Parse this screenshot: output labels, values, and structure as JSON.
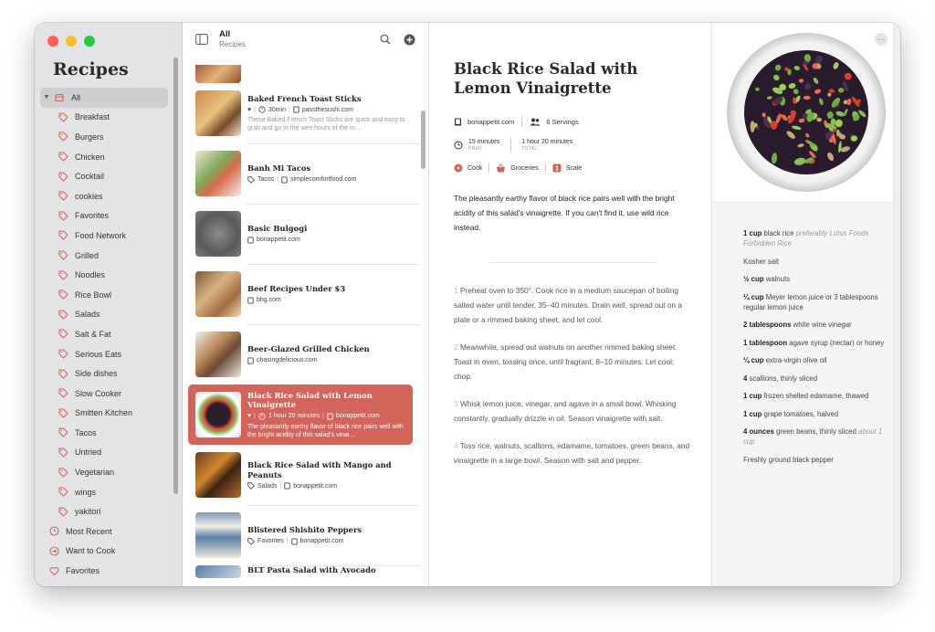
{
  "sidebar": {
    "title": "Recipes",
    "all_label": "All",
    "tags": [
      "Breakfast",
      "Burgers",
      "Chicken",
      "Cocktail",
      "cookies",
      "Favorites",
      "Food Network",
      "Grilled",
      "Noodles",
      "Rice Bowl",
      "Salads",
      "Salt & Fat",
      "Serious Eats",
      "Side dishes",
      "Slow Cooker",
      "Smitten Kitchen",
      "Tacos",
      "Untried",
      "Vegetarian",
      "wings",
      "yakitori"
    ],
    "smart": [
      {
        "label": "Most Recent",
        "icon": "clock-icon"
      },
      {
        "label": "Want to Cook",
        "icon": "arrow-circle-icon"
      },
      {
        "label": "Favorites",
        "icon": "heart-icon"
      }
    ],
    "accent": "#d2645a"
  },
  "list": {
    "title": "All",
    "subtitle": "Recipes",
    "items": [
      {
        "title": "Baked French Toast Sticks",
        "meta": [
          "♥",
          "30min",
          "passthesushi.com"
        ],
        "desc": "These Baked French Toast Sticks are quick and easy to grab and go in the wee hours of the m…"
      },
      {
        "title": "Banh Mi Tacos",
        "meta": [
          "Tacos",
          "simplecomfortfood.com"
        ],
        "desc": ""
      },
      {
        "title": "Basic Bulgogi",
        "meta": [
          "bonappetit.com"
        ],
        "desc": ""
      },
      {
        "title": "Beef Recipes Under $3",
        "meta": [
          "bhg.com"
        ],
        "desc": ""
      },
      {
        "title": "Beer-Glazed Grilled Chicken",
        "meta": [
          "chasingdelicious.com"
        ],
        "desc": ""
      },
      {
        "title": "Black Rice Salad with Lemon Vinaigrette",
        "meta": [
          "♥",
          "1 hour 20 minutes",
          "bonappetit.com"
        ],
        "desc": "The pleasantly earthy flavor of black rice pairs well with the bright acidity of this salad's vinai…"
      },
      {
        "title": "Black Rice Salad with Mango and Peanuts",
        "meta": [
          "Salads",
          "bonappetit.com"
        ],
        "desc": ""
      },
      {
        "title": "Blistered Shishito Peppers",
        "meta": [
          "Favorites",
          "bonappetit.com"
        ],
        "desc": ""
      },
      {
        "title": "BLT Pasta Salad with Avocado",
        "meta": [],
        "desc": ""
      }
    ]
  },
  "recipe": {
    "title": "Black Rice Salad with Lemon Vinaigrette",
    "source": "bonappetit.com",
    "servings": "6 Servings",
    "prep_time": "15 minutes",
    "prep_label": "PREP",
    "total_time": "1 hour 20 minutes",
    "total_label": "TOTAL",
    "actions": [
      "Cook",
      "Groceries",
      "Scale"
    ],
    "summary": "The pleasantly earthy flavor of black rice pairs well with the bright acidity of this salad's vinaigrette. If you can't find it, use wild rice instead.",
    "steps": [
      {
        "n": "1",
        "text": "Preheat oven to 350°. Cook rice in a medium saucepan of boiling salted water until tender, 35–40 minutes. Drain well, spread out on a plate or a rimmed baking sheet, and let cool."
      },
      {
        "n": "2",
        "text": "Meanwhile, spread out walnuts on another rimmed baking sheet. Toast in oven, tossing once, until fragrant, 8–10 minutes. Let cool; chop."
      },
      {
        "n": "3",
        "text": "Whisk lemon juice, vinegar, and agave in a small bowl. Whisking constantly, gradually drizzle in oil. Season vinaigrette with salt."
      },
      {
        "n": "4",
        "text": "Toss rice, walnuts, scallions, edamame, tomatoes, green beans, and vinaigrette in a large bowl. Season with salt and pepper."
      }
    ]
  },
  "ingredients": [
    {
      "qty": "1 cup",
      "text": " black rice ",
      "note": "preferably Lotus Foods Forbidden Rice"
    },
    {
      "qty": "",
      "text": "Kosher salt",
      "note": ""
    },
    {
      "qty": "½ cup",
      "text": " walnuts",
      "note": ""
    },
    {
      "qty": "¼ cup",
      "text": " Meyer lemon juice or 3 tablespoons regular lemon juice",
      "note": ""
    },
    {
      "qty": "2 tablespoons",
      "text": " white wine vinegar",
      "note": ""
    },
    {
      "qty": "1 tablespoon",
      "text": " agave syrup (nectar) or honey",
      "note": ""
    },
    {
      "qty": "¼ cup",
      "text": " extra-virgin olive oil",
      "note": ""
    },
    {
      "qty": "4",
      "text": " scallions, thinly sliced",
      "note": ""
    },
    {
      "qty": "1 cup",
      "text": " frozen shelled edamame, thawed",
      "note": ""
    },
    {
      "qty": "1 cup",
      "text": " grape tomatoes, halved",
      "note": ""
    },
    {
      "qty": "4 ounces",
      "text": " green beans, thinly sliced ",
      "note": "about 1 cup"
    },
    {
      "qty": "",
      "text": "Freshly ground black pepper",
      "note": ""
    }
  ]
}
